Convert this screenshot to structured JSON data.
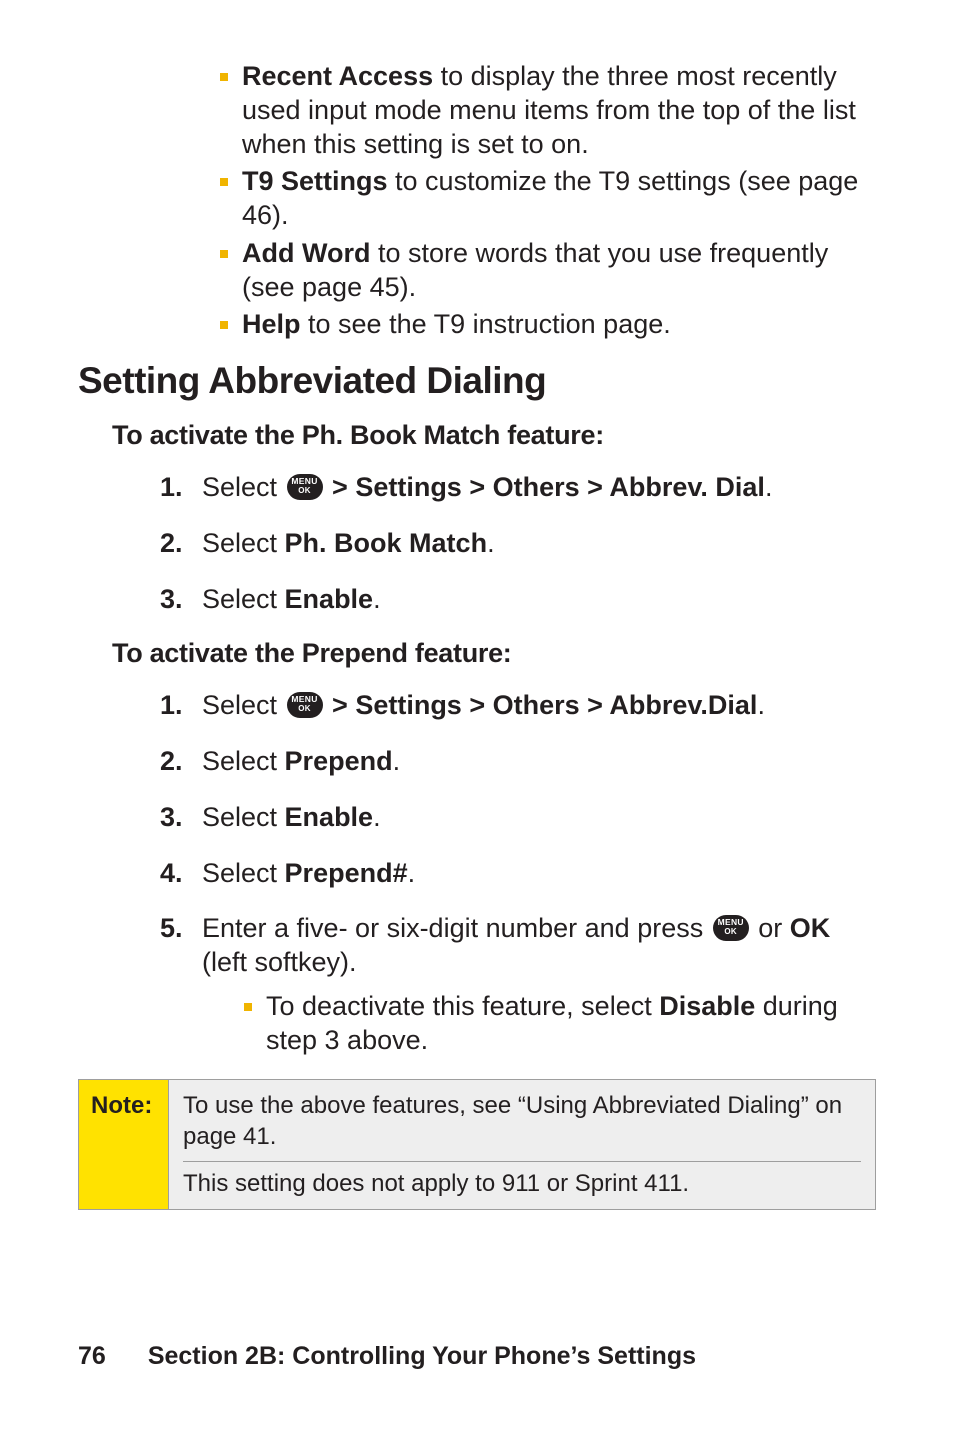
{
  "top_bullets": [
    {
      "lead": "Recent Access",
      "rest": " to display the three most recently used input mode menu items from the top of the list when this setting is set to on."
    },
    {
      "lead": "T9 Settings",
      "rest": " to customize the T9 settings (see page 46)."
    },
    {
      "lead": "Add Word",
      "rest": " to store words that you use frequently (see page 45)."
    },
    {
      "lead": "Help",
      "rest": " to see the T9 instruction page."
    }
  ],
  "section_title": "Setting Abbreviated Dialing",
  "subhead1": "To activate the Ph. Book Match feature:",
  "steps1": [
    {
      "pre": "Select ",
      "icon": true,
      "post_bold": " > Settings > Others > Abbrev. Dial",
      "tail": "."
    },
    {
      "pre": "Select ",
      "bold": "Ph. Book Match",
      "tail": "."
    },
    {
      "pre": "Select ",
      "bold": "Enable",
      "tail": "."
    }
  ],
  "subhead2": "To activate the Prepend feature:",
  "steps2": [
    {
      "pre": "Select ",
      "icon": true,
      "post_bold": " > Settings > Others > Abbrev.Dial",
      "tail": "."
    },
    {
      "pre": "Select ",
      "bold": "Prepend",
      "tail": "."
    },
    {
      "pre": "Select ",
      "bold": "Enable",
      "tail": "."
    },
    {
      "pre": "Select ",
      "bold": "Prepend#",
      "tail": "."
    },
    {
      "pre": "Enter a five- or six-digit number and press ",
      "icon": true,
      "mid": " or ",
      "bold2": "OK",
      "tail": " (left softkey).",
      "sub": {
        "pre": "To deactivate this feature, select ",
        "bold": "Disable",
        "tail": " during step 3 above."
      }
    }
  ],
  "note": {
    "label": "Note:",
    "row1": "To use the above features, see “Using Abbreviated Dialing” on page 41.",
    "row2": "This setting does not apply to 911 or Sprint 411."
  },
  "footer": {
    "page": "76",
    "text": "Section 2B: Controlling Your Phone’s Settings"
  },
  "icon": {
    "line1": "MENU",
    "line2": "OK"
  }
}
